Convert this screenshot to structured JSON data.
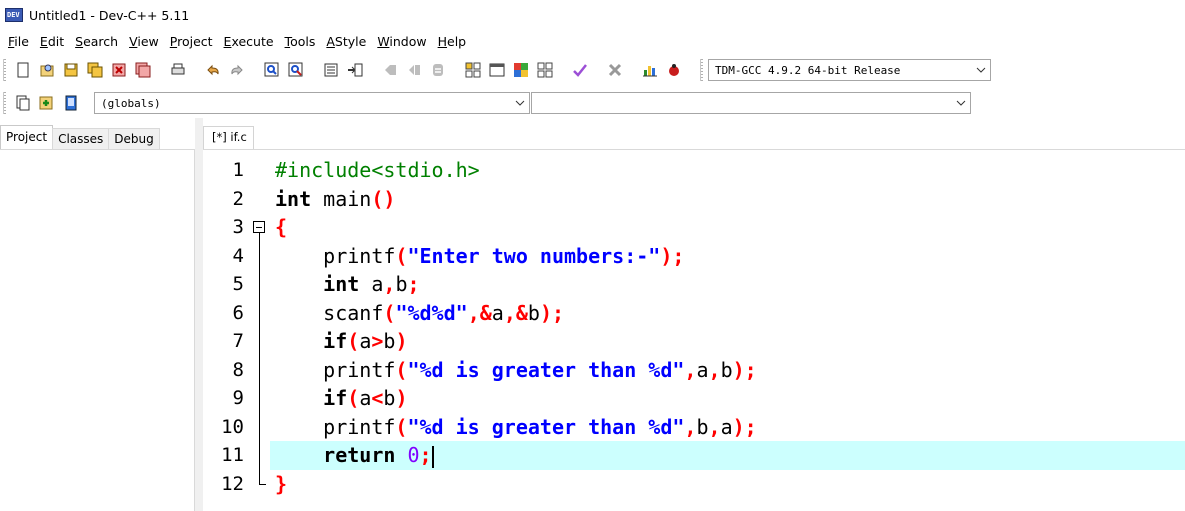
{
  "window": {
    "title": "Untitled1 - Dev-C++ 5.11",
    "icon_label": "DEV"
  },
  "menu": [
    {
      "label": "File",
      "u": "F",
      "rest": "ile"
    },
    {
      "label": "Edit",
      "u": "E",
      "rest": "dit"
    },
    {
      "label": "Search",
      "u": "S",
      "rest": "earch"
    },
    {
      "label": "View",
      "u": "V",
      "rest": "iew"
    },
    {
      "label": "Project",
      "u": "P",
      "rest": "roject"
    },
    {
      "label": "Execute",
      "u": "E",
      "rest": "xecute"
    },
    {
      "label": "Tools",
      "u": "T",
      "rest": "ools"
    },
    {
      "label": "AStyle",
      "u": "A",
      "rest": "Style"
    },
    {
      "label": "Window",
      "u": "W",
      "rest": "indow"
    },
    {
      "label": "Help",
      "u": "H",
      "rest": "elp"
    }
  ],
  "toolbar": {
    "compiler_select": "TDM-GCC 4.9.2 64-bit Release",
    "scope_select": "(globals)",
    "members_select": ""
  },
  "left_panel": {
    "tabs": [
      "Project",
      "Classes",
      "Debug"
    ],
    "active_tab": "Project"
  },
  "editor": {
    "tab_label": "[*] if.c",
    "current_line": 11,
    "lines": [
      {
        "n": "1"
      },
      {
        "n": "2"
      },
      {
        "n": "3"
      },
      {
        "n": "4"
      },
      {
        "n": "5"
      },
      {
        "n": "6"
      },
      {
        "n": "7"
      },
      {
        "n": "8"
      },
      {
        "n": "9"
      },
      {
        "n": "10"
      },
      {
        "n": "11"
      },
      {
        "n": "12"
      }
    ],
    "code": {
      "l1": {
        "pre": "#include<stdio.h>"
      },
      "l2": {
        "kw": "int",
        "rest": " main",
        "p": "()"
      },
      "l3": {
        "brace": "{"
      },
      "l4": {
        "indent": "    ",
        "fn": "printf",
        "op": "(",
        "str": "\"Enter two numbers:-\"",
        "cl": ");"
      },
      "l5": {
        "indent": "    ",
        "kw": "int",
        "a": " a",
        "c1": ",",
        "b": "b",
        "end": ";"
      },
      "l6": {
        "indent": "    ",
        "fn": "scanf",
        "op": "(",
        "str": "\"%d%d\"",
        "c1": ",&",
        "a": "a",
        "c2": ",&",
        "b": "b",
        "cl": ");"
      },
      "l7": {
        "indent": "    ",
        "kw": "if",
        "op": "(",
        "a": "a",
        "cmp": ">",
        "b": "b",
        "cl": ")"
      },
      "l8": {
        "indent": "    ",
        "fn": "printf",
        "op": "(",
        "str": "\"%d is greater than %d\"",
        "c1": ",",
        "a": "a",
        "c2": ",",
        "b": "b",
        "cl": ");"
      },
      "l9": {
        "indent": "    ",
        "kw": "if",
        "op": "(",
        "a": "a",
        "cmp": "<",
        "b": "b",
        "cl": ")"
      },
      "l10": {
        "indent": "    ",
        "fn": "printf",
        "op": "(",
        "str": "\"%d is greater than %d\"",
        "c1": ",",
        "a": "b",
        "c2": ",",
        "b": "a",
        "cl": ");"
      },
      "l11": {
        "indent": "    ",
        "kw": "return",
        "sp": " ",
        "num": "0",
        "end": ";"
      },
      "l12": {
        "brace": "}"
      }
    }
  },
  "colors": {
    "current_line_bg": "#ccfffe",
    "string": "#0000ff",
    "symbol": "#ff0000",
    "preprocessor": "#008000",
    "number": "#8000ff"
  }
}
